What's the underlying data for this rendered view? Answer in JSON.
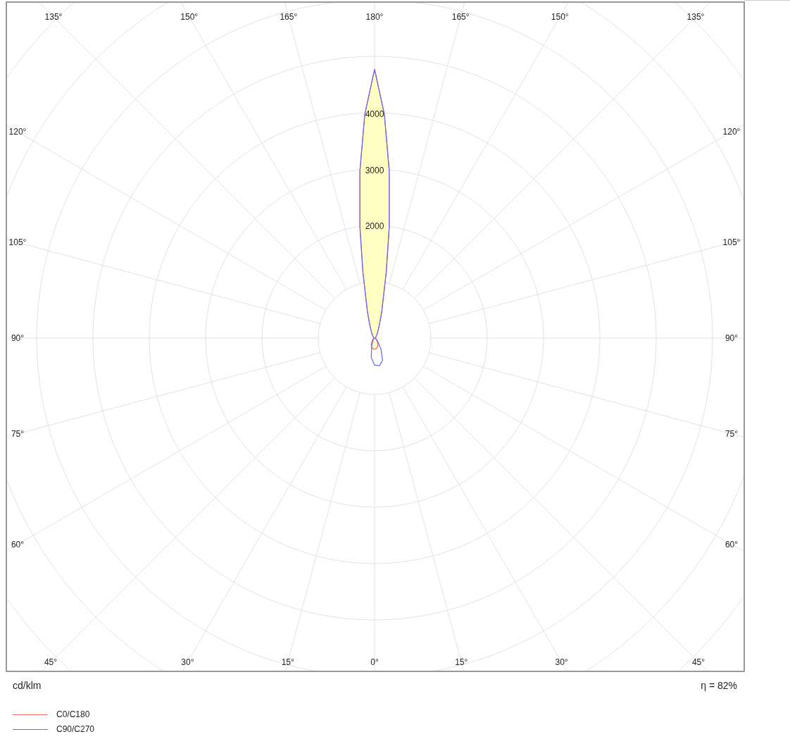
{
  "polar_chart": {
    "angle_labels_top": [
      "135°",
      "150°",
      "165°",
      "180°",
      "165°",
      "150°",
      "135°"
    ],
    "angle_labels_left": [
      "120°",
      "105°",
      "90°",
      "75°",
      "60°"
    ],
    "angle_labels_right": [
      "120°",
      "105°",
      "90°",
      "75°",
      "60°"
    ],
    "angle_labels_bottom": [
      "45°",
      "30°",
      "15°",
      "0°",
      "15°",
      "30°",
      "45°"
    ],
    "ring_labels": [
      "4000",
      "3000",
      "2000"
    ],
    "unit_label": "cd/klm",
    "efficiency": "η = 82%",
    "legend": [
      {
        "name": "C0/C180",
        "color": "#ff6666"
      },
      {
        "name": "C90/C270",
        "color": "#6666ff"
      }
    ]
  }
}
